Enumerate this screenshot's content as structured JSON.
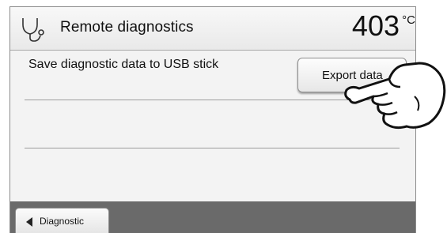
{
  "header": {
    "title": "Remote diagnostics",
    "temperature": "403",
    "unit": "°C",
    "icon": "stethoscope-icon"
  },
  "main": {
    "row_label": "Save diagnostic data to USB stick",
    "export_label": "Export data"
  },
  "footer": {
    "back_label": "Diagnostic",
    "back_icon": "triangle-left-icon"
  },
  "overlay": {
    "icon": "pointing-hand-icon"
  },
  "colors": {
    "screen_bg": "#f3f3f3",
    "footer_bg": "#6a6a6a",
    "divider": "#9c9c9c"
  }
}
